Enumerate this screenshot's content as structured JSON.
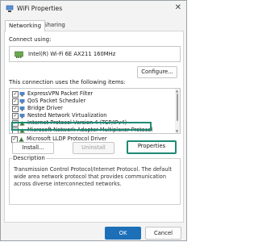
{
  "window": {
    "title": "WiFi Properties",
    "close_glyph": "✕"
  },
  "tabs": [
    {
      "label": "Networking"
    },
    {
      "label": "Sharing"
    }
  ],
  "connect_using": {
    "label": "Connect using:",
    "adapter_name": "Intel(R) Wi-Fi 6E AX211 160MHz",
    "configure_label": "Configure..."
  },
  "items_label": "This connection uses the following items:",
  "items": [
    {
      "label": "ExpressVPN Packet Filter",
      "checked": true,
      "icon": "network-component-icon"
    },
    {
      "label": "QoS Packet Scheduler",
      "checked": true,
      "icon": "network-component-icon"
    },
    {
      "label": "Bridge Driver",
      "checked": true,
      "icon": "network-component-icon"
    },
    {
      "label": "Nested Network Virtualization",
      "checked": true,
      "icon": "network-component-icon"
    },
    {
      "label": "Internet Protocol Version 4 (TCP/IPv4)",
      "checked": true,
      "icon": "protocol-icon"
    },
    {
      "label": "Microsoft Network Adapter Multiplexor Protocol",
      "checked": false,
      "icon": "protocol-icon"
    },
    {
      "label": "Microsoft LLDP Protocol Driver",
      "checked": true,
      "icon": "protocol-icon"
    }
  ],
  "buttons": {
    "install": "Install...",
    "uninstall": "Uninstall",
    "properties": "Properties",
    "ok": "OK",
    "cancel": "Cancel"
  },
  "description": {
    "legend": "Description",
    "text": "Transmission Control Protocol/Internet Protocol. The default wide area network protocol that provides communication across diverse interconnected networks."
  },
  "colors": {
    "highlight": "#1e8a74",
    "primary": "#1d6fb8"
  }
}
